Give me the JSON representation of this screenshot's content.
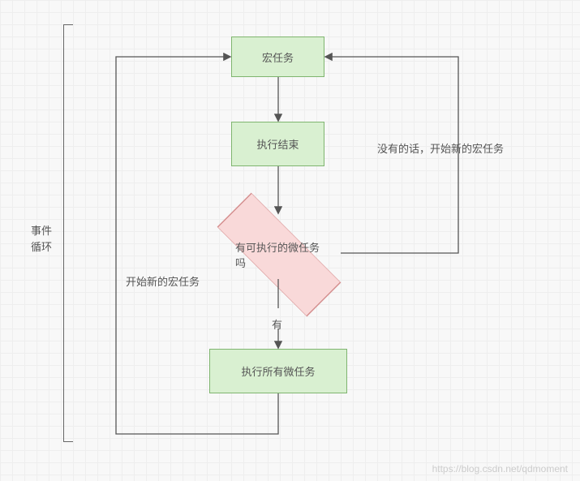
{
  "sidebar": {
    "label_line1": "事件",
    "label_line2": "循环"
  },
  "nodes": {
    "macro_task": "宏任务",
    "exec_end": "执行结束",
    "decision": "有可执行的微任务吗",
    "exec_all_micro": "执行所有微任务"
  },
  "edges": {
    "has_micro": "有",
    "start_new_macro_left": "开始新的宏任务",
    "no_new_macro_right": "没有的话，开始新的宏任务"
  },
  "watermark": "https://blog.csdn.net/qdmoment"
}
